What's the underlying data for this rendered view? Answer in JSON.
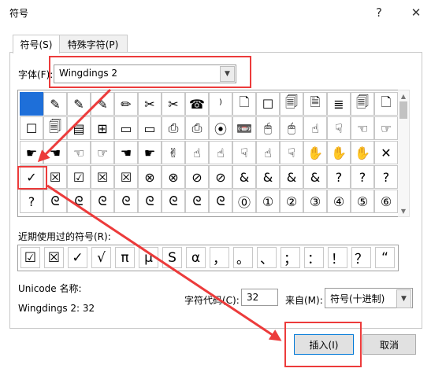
{
  "window": {
    "title": "符号"
  },
  "tabs": [
    {
      "label": "符号(S)"
    },
    {
      "label": "特殊字符(P)"
    }
  ],
  "font": {
    "label": "字体(F):",
    "value": "Wingdings 2"
  },
  "grid": {
    "rows": [
      [
        "",
        "✎",
        "✎",
        "✎",
        "✏",
        "✂",
        "✂",
        "☎",
        "⁾",
        "🗋",
        "☐",
        "🗐",
        "🗎",
        "≣",
        "🗐",
        "🗋"
      ],
      [
        "☐",
        "🗐",
        "▤",
        "⊞",
        "▭",
        "▭",
        "⎙",
        "⎙",
        "⦿",
        "📼",
        "🖱",
        "🖱",
        "☝",
        "☟",
        "☜",
        "☞"
      ],
      [
        "☛",
        "☚",
        "☜",
        "☞",
        "☚",
        "☛",
        "✌",
        "☝",
        "☝",
        "☟",
        "☝",
        "☟",
        "✋",
        "✋",
        "✋",
        "✕"
      ],
      [
        "✓",
        "☒",
        "☑",
        "☒",
        "☒",
        "⊗",
        "⊗",
        "⊘",
        "⊘",
        "&",
        "&",
        "&",
        "&",
        "?",
        "?",
        "?"
      ],
      [
        "?",
        "ᘓ",
        "ᘓ",
        "ᘓ",
        "ᘓ",
        "ᘓ",
        "ᘓ",
        "ᘓ",
        "ᘓ",
        "⓪",
        "①",
        "②",
        "③",
        "④",
        "⑤",
        "⑥"
      ]
    ]
  },
  "recent": {
    "label": "近期使用过的符号(R):",
    "symbols": [
      "☑",
      "☒",
      "✓",
      "√",
      "π",
      "μ",
      "S",
      "α",
      "，",
      "。",
      "、",
      "；",
      "：",
      "！",
      "？",
      "“"
    ]
  },
  "unicode": {
    "name_label": "Unicode 名称:",
    "name_value": "Wingdings 2: 32"
  },
  "charcode": {
    "label": "字符代码(C):",
    "value": "32"
  },
  "from": {
    "label": "来自(M):",
    "value": "符号(十进制)"
  },
  "buttons": {
    "insert": "插入(I)",
    "cancel": "取消"
  },
  "colors": {
    "accent": "#1e6fd9",
    "annotation": "#ec3b3b"
  }
}
